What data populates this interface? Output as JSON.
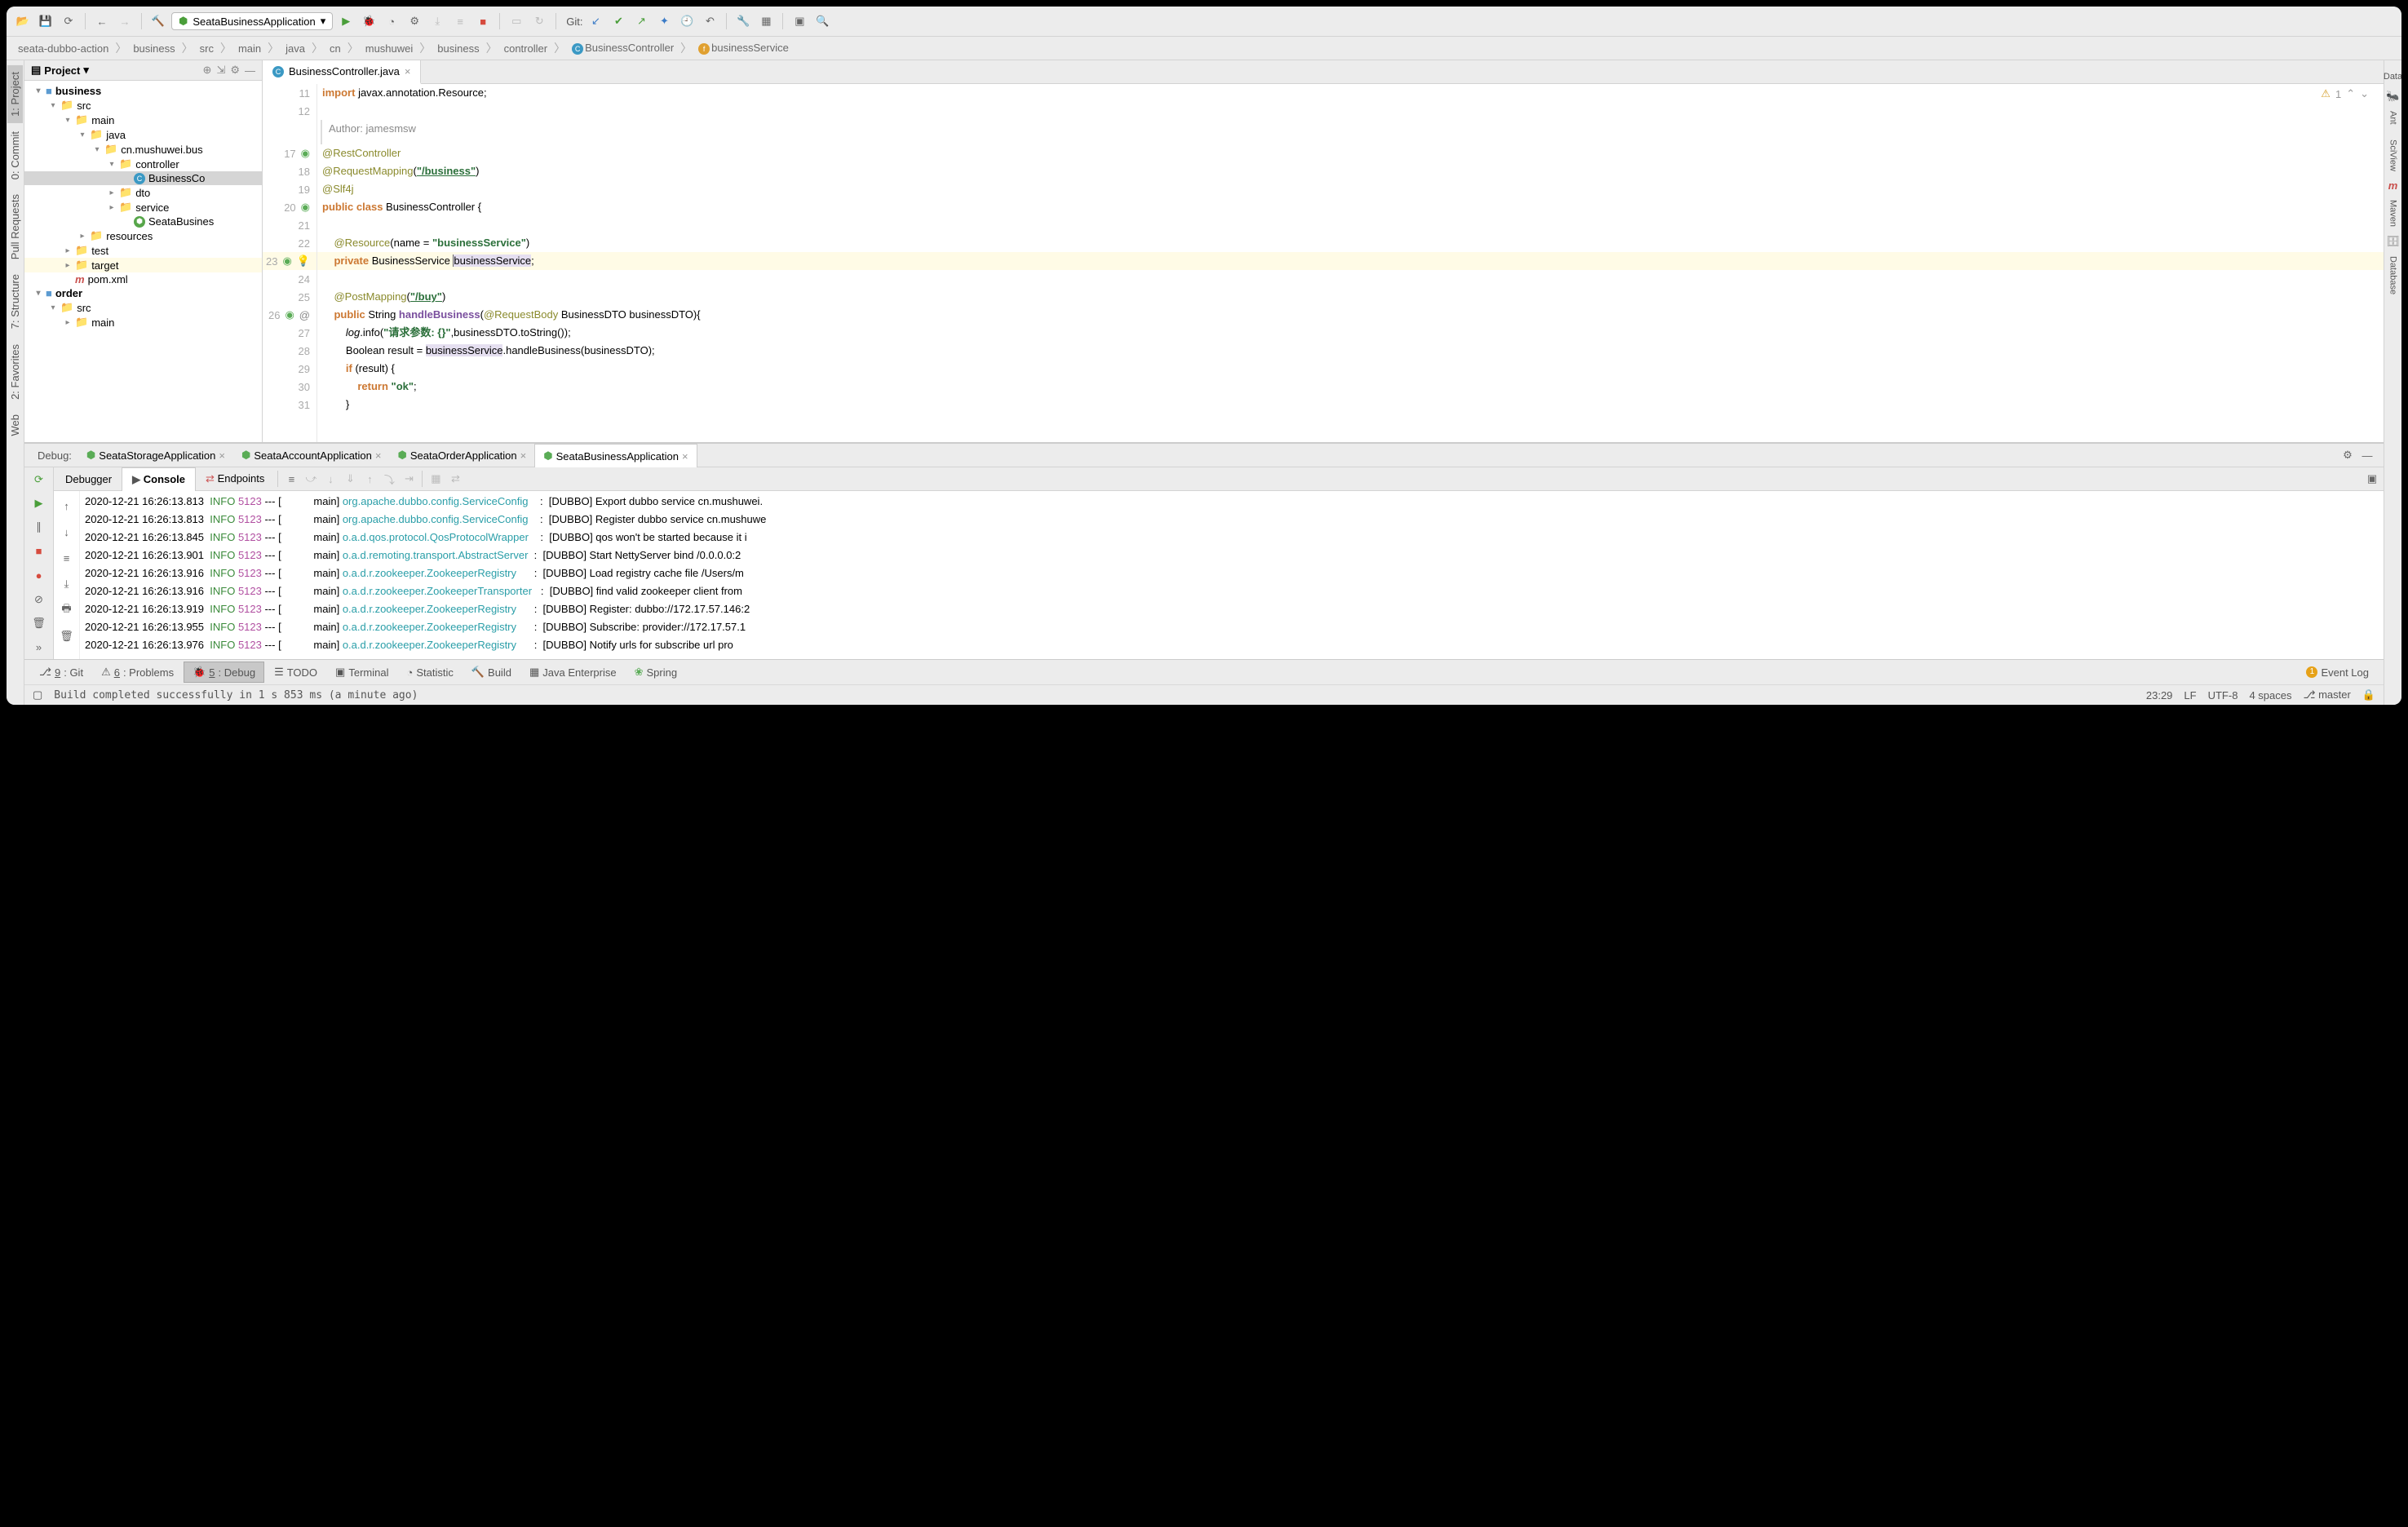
{
  "runConfig": {
    "name": "SeataBusinessApplication"
  },
  "gitLabel": "Git:",
  "breadcrumb": [
    "seata-dubbo-action",
    "business",
    "src",
    "main",
    "java",
    "cn",
    "mushuwei",
    "business",
    "controller",
    "BusinessController",
    "businessService"
  ],
  "projectHeader": {
    "title": "Project"
  },
  "tree": {
    "business": "business",
    "src": "src",
    "main": "main",
    "java": "java",
    "pkg": "cn.mushuwei.bus",
    "controller": "controller",
    "file1": "BusinessCo",
    "dto": "dto",
    "service": "service",
    "file2": "SeataBusines",
    "resources": "resources",
    "test": "test",
    "target": "target",
    "pom": "pom.xml",
    "order": "order",
    "ordersrc": "src",
    "ordermain": "main"
  },
  "editor": {
    "tab": "BusinessController.java",
    "author": "Author: jamesmsw",
    "inspections": {
      "warn": "1"
    },
    "lines": {
      "11": [
        "11",
        "import javax.annotation.Resource;"
      ],
      "12": [
        "12",
        ""
      ],
      "17": [
        "17",
        "@RestController"
      ],
      "18": [
        "18",
        "@RequestMapping(\"/business\")"
      ],
      "19": [
        "19",
        "@Slf4j"
      ],
      "20": [
        "20",
        "public class BusinessController {"
      ],
      "21": [
        "21",
        ""
      ],
      "22": [
        "22",
        "    @Resource(name = \"businessService\")"
      ],
      "23": [
        "23",
        "    private BusinessService businessService;"
      ],
      "24": [
        "24",
        ""
      ],
      "25": [
        "25",
        "    @PostMapping(\"/buy\")"
      ],
      "26": [
        "26",
        "    public String handleBusiness(@RequestBody BusinessDTO businessDTO){"
      ],
      "27": [
        "27",
        "        log.info(\"请求参数: {}\",businessDTO.toString());"
      ],
      "28": [
        "28",
        "        Boolean result = businessService.handleBusiness(businessDTO);"
      ],
      "29": [
        "29",
        "        if (result) {"
      ],
      "30": [
        "30",
        "            return \"ok\";"
      ],
      "31": [
        "31",
        "        }"
      ]
    }
  },
  "debug": {
    "label": "Debug:",
    "tabs": [
      "SeataStorageApplication",
      "SeataAccountApplication",
      "SeataOrderApplication",
      "SeataBusinessApplication"
    ],
    "subtabs": [
      "Debugger",
      "Console",
      "Endpoints"
    ],
    "log": [
      {
        "ts": "2020-12-21 16:26:13.813",
        "lvl": "INFO",
        "pid": "5123",
        "thread": "main",
        "cls": "org.apache.dubbo.config.ServiceConfig",
        "msg": "[DUBBO] Export dubbo service cn.mushuwei."
      },
      {
        "ts": "2020-12-21 16:26:13.813",
        "lvl": "INFO",
        "pid": "5123",
        "thread": "main",
        "cls": "org.apache.dubbo.config.ServiceConfig",
        "msg": "[DUBBO] Register dubbo service cn.mushuwe"
      },
      {
        "ts": "2020-12-21 16:26:13.845",
        "lvl": "INFO",
        "pid": "5123",
        "thread": "main",
        "cls": "o.a.d.qos.protocol.QosProtocolWrapper",
        "msg": "[DUBBO] qos won't be started because it i"
      },
      {
        "ts": "2020-12-21 16:26:13.901",
        "lvl": "INFO",
        "pid": "5123",
        "thread": "main",
        "cls": "o.a.d.remoting.transport.AbstractServer",
        "msg": "[DUBBO] Start NettyServer bind /0.0.0.0:2"
      },
      {
        "ts": "2020-12-21 16:26:13.916",
        "lvl": "INFO",
        "pid": "5123",
        "thread": "main",
        "cls": "o.a.d.r.zookeeper.ZookeeperRegistry",
        "msg": "[DUBBO] Load registry cache file /Users/m"
      },
      {
        "ts": "2020-12-21 16:26:13.916",
        "lvl": "INFO",
        "pid": "5123",
        "thread": "main",
        "cls": "o.a.d.r.zookeeper.ZookeeperTransporter",
        "msg": "[DUBBO] find valid zookeeper client from"
      },
      {
        "ts": "2020-12-21 16:26:13.919",
        "lvl": "INFO",
        "pid": "5123",
        "thread": "main",
        "cls": "o.a.d.r.zookeeper.ZookeeperRegistry",
        "msg": "[DUBBO] Register: dubbo://172.17.57.146:2"
      },
      {
        "ts": "2020-12-21 16:26:13.955",
        "lvl": "INFO",
        "pid": "5123",
        "thread": "main",
        "cls": "o.a.d.r.zookeeper.ZookeeperRegistry",
        "msg": "[DUBBO] Subscribe: provider://172.17.57.1"
      },
      {
        "ts": "2020-12-21 16:26:13.976",
        "lvl": "INFO",
        "pid": "5123",
        "thread": "main",
        "cls": "o.a.d.r.zookeeper.ZookeeperRegistry",
        "msg": "[DUBBO] Notify urls for subscribe url pro"
      }
    ]
  },
  "bottomTools": {
    "git": "9: Git",
    "problems": "6: Problems",
    "debug": "5: Debug",
    "todo": "TODO",
    "terminal": "Terminal",
    "statistic": "Statistic",
    "build": "Build",
    "jee": "Java Enterprise",
    "spring": "Spring",
    "eventLog": "Event Log"
  },
  "rightRail": {
    "data": "Data",
    "ant": "Ant",
    "sciview": "SciView",
    "maven": "Maven",
    "database": "Database"
  },
  "leftRail": {
    "project": "1: Project",
    "commit": "0: Commit",
    "pull": "Pull Requests",
    "structure": "7: Structure",
    "favorites": "2: Favorites",
    "web": "Web"
  },
  "status": {
    "message": "Build completed successfully in 1 s 853 ms (a minute ago)",
    "pos": "23:29",
    "eol": "LF",
    "enc": "UTF-8",
    "indent": "4 spaces",
    "branch": "master"
  }
}
